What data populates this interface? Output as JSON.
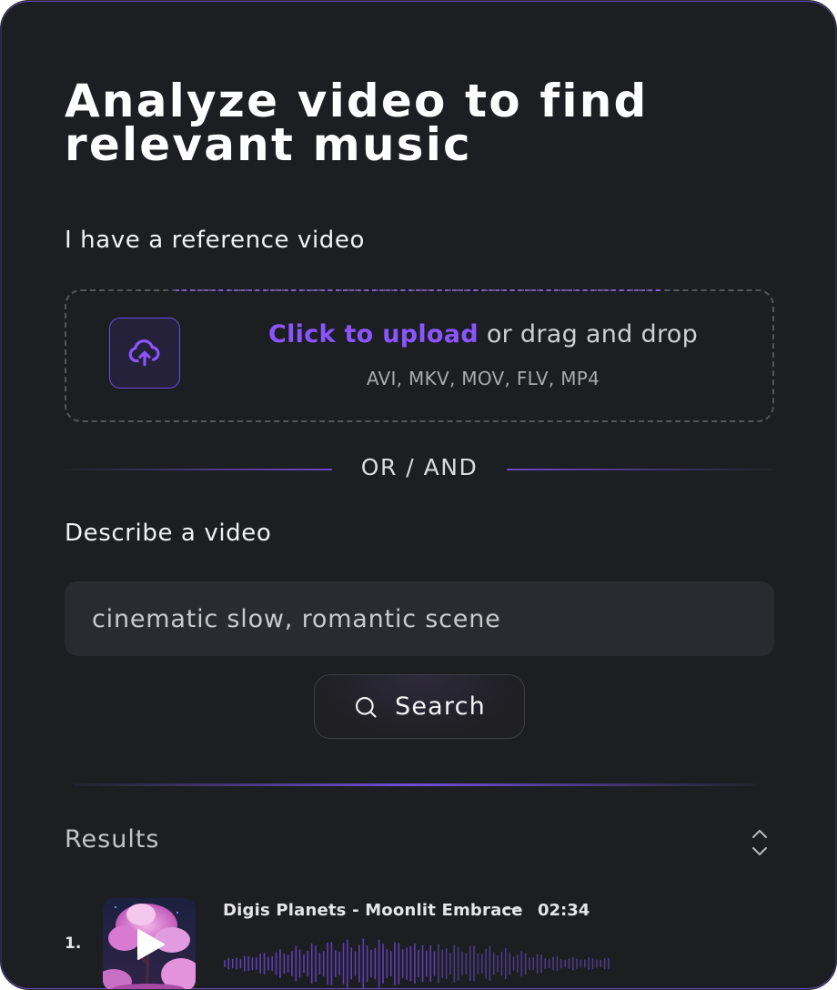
{
  "header": {
    "title_line1": "Analyze video to find",
    "title_line2": "relevant music"
  },
  "reference": {
    "label": "I have a reference video",
    "upload_link": "Click to upload",
    "upload_suffix": " or drag and drop",
    "formats": "AVI, MKV, MOV, FLV, MP4",
    "icon": "cloud-upload-icon"
  },
  "divider": {
    "text": "OR / AND"
  },
  "describe": {
    "label": "Describe a video",
    "input_value": "cinematic slow, romantic scene",
    "search_label": "Search",
    "search_icon": "search-icon"
  },
  "results": {
    "title": "Results",
    "sort_icon": "chevrons-up-down-icon",
    "items": [
      {
        "index": "1.",
        "title": "Digis Planets - Moonlit Embrace",
        "separator": "—",
        "duration": "02:34",
        "play_icon": "play-icon"
      }
    ]
  },
  "colors": {
    "background": "#1d1e21",
    "accent": "#8a55ff",
    "input_bg": "#2a2b30",
    "text_primary": "#ffffff",
    "text_secondary": "#c4c4ca"
  }
}
